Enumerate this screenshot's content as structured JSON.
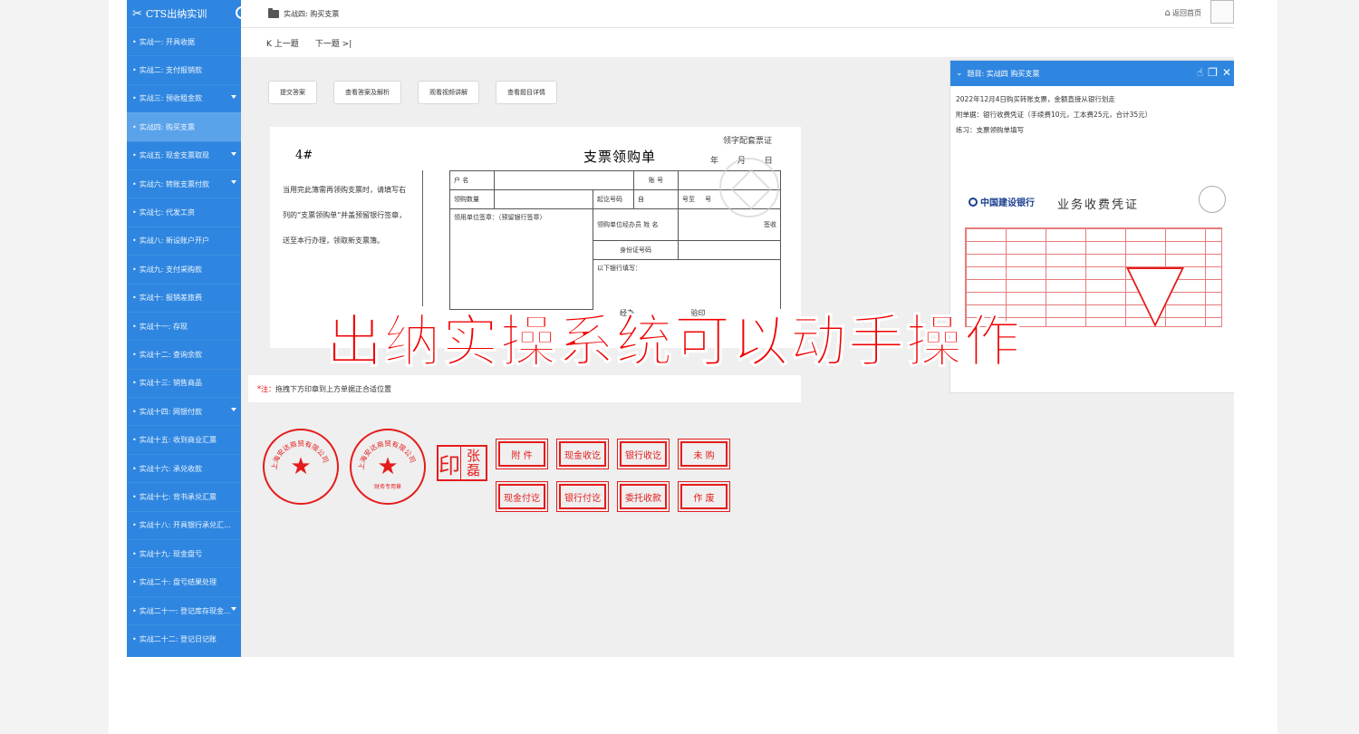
{
  "sidebar": {
    "brand": "CTS出纳实训",
    "items": [
      {
        "label": "实战一: 开具收据",
        "active": false,
        "expandable": false
      },
      {
        "label": "实战二: 支付报销款",
        "active": false,
        "expandable": false
      },
      {
        "label": "实战三: 预收租金款",
        "active": false,
        "expandable": true
      },
      {
        "label": "实战四: 购买支票",
        "active": true,
        "expandable": false
      },
      {
        "label": "实战五: 现金支票取现",
        "active": false,
        "expandable": true
      },
      {
        "label": "实战六: 转账支票付款",
        "active": false,
        "expandable": true
      },
      {
        "label": "实战七: 代发工资",
        "active": false,
        "expandable": false
      },
      {
        "label": "实战八: 新设账户开户",
        "active": false,
        "expandable": false
      },
      {
        "label": "实战九: 支付采购款",
        "active": false,
        "expandable": false
      },
      {
        "label": "实战十: 报销差旅费",
        "active": false,
        "expandable": false
      },
      {
        "label": "实战十一: 存现",
        "active": false,
        "expandable": false
      },
      {
        "label": "实战十二: 查询余款",
        "active": false,
        "expandable": false
      },
      {
        "label": "实战十三: 销售商品",
        "active": false,
        "expandable": false
      },
      {
        "label": "实战十四: 网银付款",
        "active": false,
        "expandable": true
      },
      {
        "label": "实战十五: 收到商业汇票",
        "active": false,
        "expandable": false
      },
      {
        "label": "实战十六: 承兑收款",
        "active": false,
        "expandable": false
      },
      {
        "label": "实战十七: 背书承兑汇票",
        "active": false,
        "expandable": false
      },
      {
        "label": "实战十八: 开具银行承兑汇...",
        "active": false,
        "expandable": false
      },
      {
        "label": "实战十九: 现金盘亏",
        "active": false,
        "expandable": false
      },
      {
        "label": "实战二十: 盘亏结果处理",
        "active": false,
        "expandable": false
      },
      {
        "label": "实战二十一: 登记库存现金...",
        "active": false,
        "expandable": true
      },
      {
        "label": "实战二十二: 登记日记账",
        "active": false,
        "expandable": false
      }
    ]
  },
  "topbar": {
    "breadcrumb": "实战四: 购买支票",
    "home": "返回首页"
  },
  "nav": {
    "prev": "上一题",
    "next": "下一题"
  },
  "buttons": [
    "提交答案",
    "查看答案及解析",
    "观看视频讲解",
    "查看题目详情"
  ],
  "form": {
    "number": "4#",
    "title": "支票领购单",
    "stamp_label": "领字配套票证",
    "date": "年 月 日",
    "note": "当用完此簿需再领购支票时，请填写右列的“支票领购单”并盖预留银行签章，送至本行办理，领取新支票簿。",
    "table": {
      "name_label": "户 名",
      "account_label": "账 号",
      "qty_label": "领购数量",
      "start_label": "起讫号码",
      "from_label": "自",
      "to_label": "号至",
      "end_label": "号",
      "seal_label": "领用单位签章：（预留银行签章）",
      "agent_label": "领购单位经办员 姓 名",
      "sign_label": "签收",
      "id_label": "身份证号码",
      "bank_fill": "以下银行填写：",
      "stock_label": "经办",
      "check_label": "验印"
    }
  },
  "tip": {
    "prefix": "*注：",
    "text": "拖拽下方印章到上方单据正合适位置"
  },
  "stamps": {
    "round1_text": "上海安达商贸有限公司",
    "round2_text": "上海安达商贸有限公司",
    "round2_inner": "财务专用章",
    "name_seal_yin": "印",
    "name_seal_name": "张磊",
    "small": [
      "附 件",
      "现金收讫",
      "银行收讫",
      "未 购",
      "现金付讫",
      "银行付讫",
      "委托收款",
      "作 废"
    ]
  },
  "panel": {
    "title": "题目: 实战四 购买支票",
    "lines": [
      "2022年12月4日购买转账支票，金额直接从银行划走",
      "附单据：银行收费凭证（手续费10元，工本费25元，合计35元）",
      "练习：支票领购单填写"
    ],
    "receipt": {
      "bank": "中国建设银行",
      "title": "业务收费凭证"
    }
  },
  "overlay_text": "出纳实操系统可以动手操作",
  "colors": {
    "sidebar": "#2f86e0",
    "accent_red": "#e51c1c",
    "overlay_red": "#f00000"
  }
}
